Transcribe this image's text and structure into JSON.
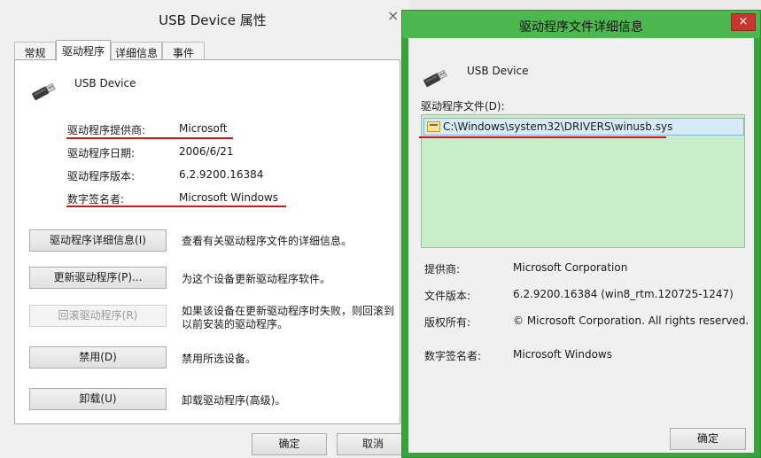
{
  "left": {
    "title": "USB Device 属性",
    "close_glyph": "×",
    "tabs": [
      {
        "label": "常规"
      },
      {
        "label": "驱动程序"
      },
      {
        "label": "详细信息"
      },
      {
        "label": "事件"
      }
    ],
    "device_name": "USB Device",
    "props": {
      "provider_label": "驱动程序提供商:",
      "provider_value": "Microsoft",
      "date_label": "驱动程序日期:",
      "date_value": "2006/6/21",
      "version_label": "驱动程序版本:",
      "version_value": "6.2.9200.16384",
      "signer_label": "数字签名者:",
      "signer_value": "Microsoft Windows"
    },
    "actions": [
      {
        "button": "驱动程序详细信息(I)",
        "desc": "查看有关驱动程序文件的详细信息。"
      },
      {
        "button": "更新驱动程序(P)...",
        "desc": "为这个设备更新驱动程序软件。"
      },
      {
        "button": "回滚驱动程序(R)",
        "desc": "如果该设备在更新驱动程序时失败，则回滚到以前安装的驱动程序。"
      },
      {
        "button": "禁用(D)",
        "desc": "禁用所选设备。"
      },
      {
        "button": "卸载(U)",
        "desc": "卸载驱动程序(高级)。"
      }
    ],
    "ok_label": "确定",
    "cancel_label": "取消"
  },
  "right": {
    "title": "驱动程序文件详细信息",
    "close_glyph": "×",
    "device_name": "USB Device",
    "files_label": "驱动程序文件(D):",
    "files": [
      "C:\\Windows\\system32\\DRIVERS\\winusb.sys"
    ],
    "details": {
      "provider_label": "提供商:",
      "provider_value": "Microsoft Corporation",
      "version_label": "文件版本:",
      "version_value": "6.2.9200.16384 (win8_rtm.120725-1247)",
      "copyright_label": "版权所有:",
      "copyright_value": "© Microsoft Corporation. All rights reserved.",
      "signer_label": "数字签名者:",
      "signer_value": "Microsoft Windows"
    },
    "ok_label": "确定"
  },
  "colors": {
    "highlight_underline": "#d31717",
    "right_frame": "#36a33b",
    "file_list_bg": "#c9ecc9"
  },
  "icons": {
    "usb": "usb-drive-icon",
    "file": "system-file-icon"
  }
}
